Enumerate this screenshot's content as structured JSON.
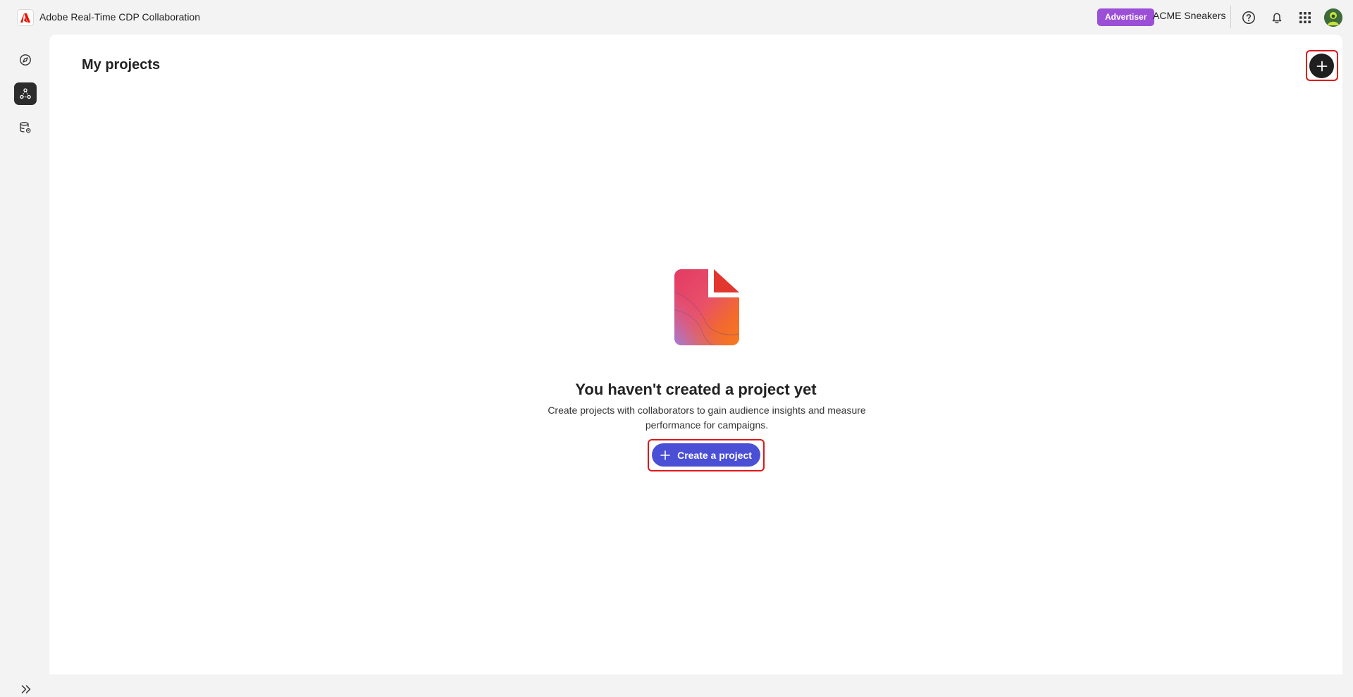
{
  "header": {
    "app_title": "Adobe Real-Time CDP Collaboration",
    "role_badge": "Advertiser",
    "org_name": "ACME Sneakers",
    "icons": [
      "adobe-logo-icon",
      "help-icon",
      "bell-icon",
      "app-grid-icon",
      "avatar"
    ]
  },
  "sidebar": {
    "items": [
      {
        "icon": "discover-icon",
        "active": false
      },
      {
        "icon": "projects-icon",
        "active": true
      },
      {
        "icon": "data-settings-icon",
        "active": false
      }
    ],
    "expand_icon": "chevron-double-right-icon"
  },
  "main": {
    "title": "My projects",
    "add_button_icon": "plus-icon",
    "empty_state": {
      "illustration": "document-illustration-icon",
      "heading": "You haven't created a project yet",
      "description": "Create projects with collaborators to gain audience insights and measure performance for campaigns.",
      "cta_label": "Create a project"
    }
  },
  "colors": {
    "accent": "#4b4fd6",
    "badge": "#9b4fd6",
    "highlight": "#e0161b"
  }
}
